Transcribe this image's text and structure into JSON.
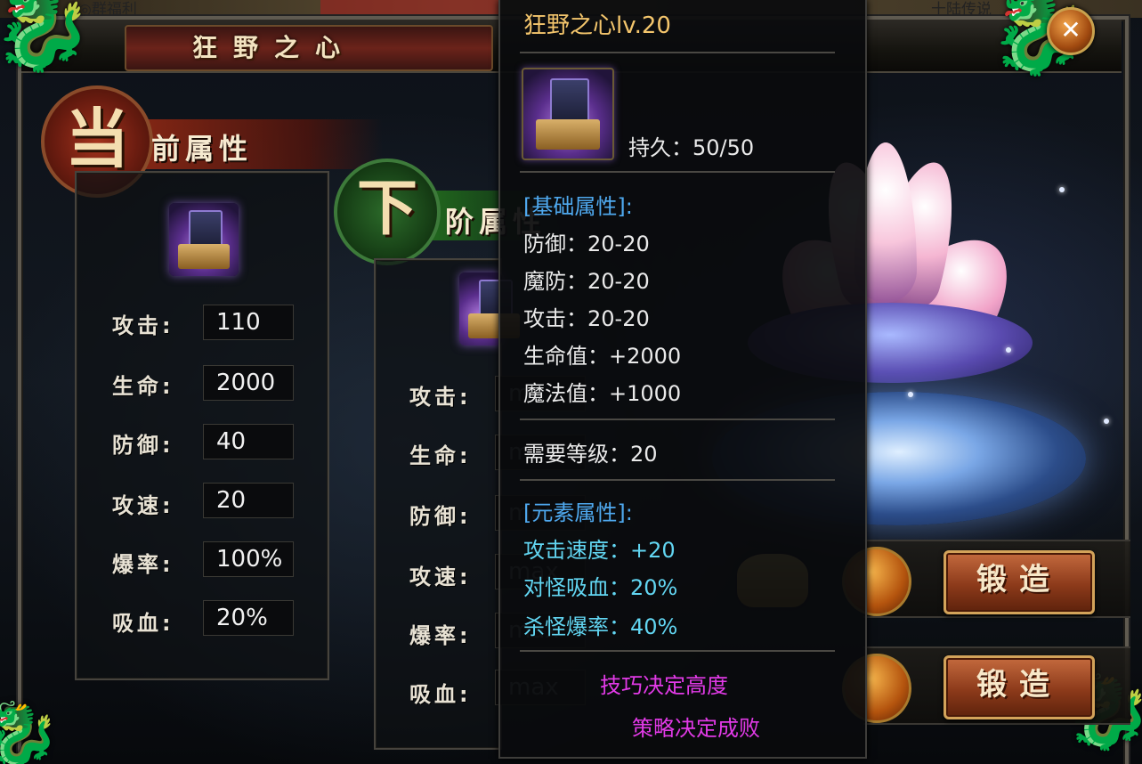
{
  "top_strip": {
    "left_text": "◎群福利",
    "right_text": "十陆传说"
  },
  "window": {
    "title": "狂野之心",
    "close_glyph": "✕"
  },
  "current": {
    "badge_char": "当",
    "heading": "前属性",
    "attributes": [
      {
        "label": "攻击:",
        "value": "110"
      },
      {
        "label": "生命:",
        "value": "2000"
      },
      {
        "label": "防御:",
        "value": "40"
      },
      {
        "label": "攻速:",
        "value": "20"
      },
      {
        "label": "爆率:",
        "value": "100%"
      },
      {
        "label": "吸血:",
        "value": "20%"
      }
    ]
  },
  "next": {
    "badge_char": "下",
    "heading": "阶属性",
    "attributes": [
      {
        "label": "攻击:",
        "value": "max"
      },
      {
        "label": "生命:",
        "value": "max"
      },
      {
        "label": "防御:",
        "value": "max"
      },
      {
        "label": "攻速:",
        "value": "max"
      },
      {
        "label": "爆率:",
        "value": "max"
      },
      {
        "label": "吸血:",
        "value": "max"
      }
    ]
  },
  "tooltip": {
    "title": "狂野之心lv.20",
    "durability": "持久：50/50",
    "base_header": "[基础属性]:",
    "base": [
      "防御：20-20",
      "魔防：20-20",
      "攻击：20-20",
      "生命值：+2000",
      "魔法值：+1000"
    ],
    "required_level": "需要等级：20",
    "element_header": "[元素属性]:",
    "element": [
      "攻击速度：+20",
      "对怪吸血：20%",
      "杀怪爆率：40%"
    ],
    "slogan_1": "技巧决定高度",
    "slogan_2": "策略决定成败"
  },
  "forge": {
    "button_label": "锻造"
  },
  "colors": {
    "gold_title": "#f3c56c",
    "cyan_header": "#4fa9ef",
    "aqua_text": "#62d6f2",
    "magenta_text": "#e23ae7"
  },
  "icons": [
    "dragon-ornament-icon",
    "close-icon",
    "gem-box-item-icon",
    "gold-coin-icon",
    "gold-ingot-icon"
  ]
}
